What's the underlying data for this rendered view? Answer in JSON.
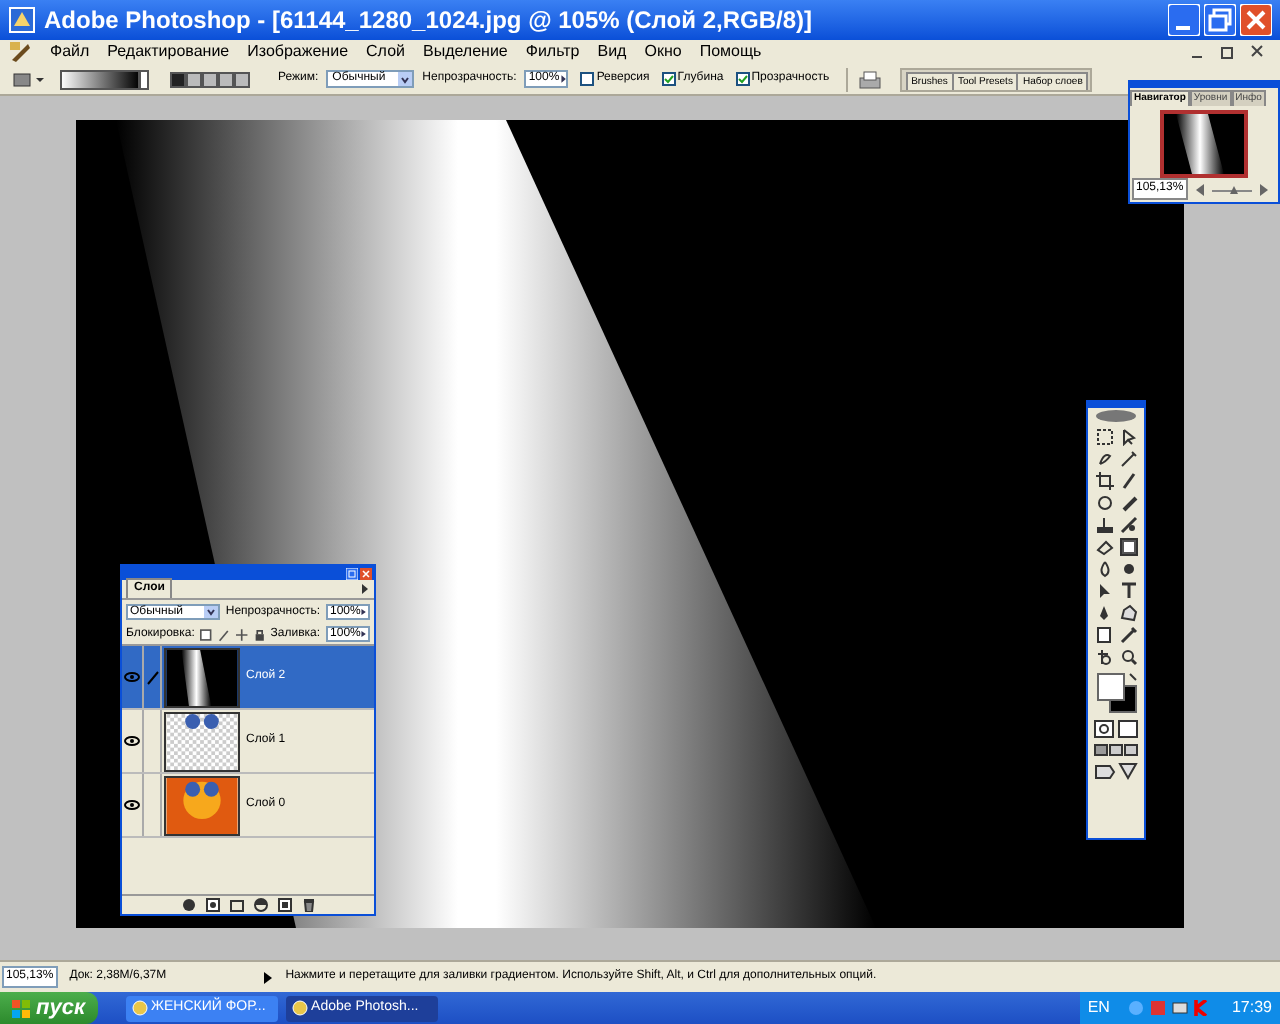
{
  "window": {
    "title": "Adobe Photoshop - [61144_1280_1024.jpg @ 105% (Слой 2,RGB/8)]"
  },
  "menu": [
    "Файл",
    "Редактирование",
    "Изображение",
    "Слой",
    "Выделение",
    "Фильтр",
    "Вид",
    "Окно",
    "Помощь"
  ],
  "options_bar": {
    "gradient_types": [
      {
        "selected": true
      },
      {
        "selected": false
      },
      {
        "selected": false
      },
      {
        "selected": false
      },
      {
        "selected": false
      }
    ],
    "mode_label": "Режим:",
    "mode": "Обычный",
    "opacity_label": "Непрозрачность:",
    "opacity": "100%",
    "checkboxes": [
      {
        "label": "Реверсия",
        "checked": false
      },
      {
        "label": "Глубина",
        "checked": true
      },
      {
        "label": "Прозрачность",
        "checked": true
      }
    ]
  },
  "palette_well": [
    "Brushes",
    "Tool Presets",
    "Набор слоев"
  ],
  "navigator": {
    "tabs": [
      {
        "label": "Навигатор",
        "selected": true
      },
      {
        "label": "Уровни",
        "selected": false
      },
      {
        "label": "Инфо",
        "selected": false
      }
    ],
    "zoom": "105,13%",
    "zoom_slider": {
      "level": 0.6
    }
  },
  "layers_panel": {
    "tab": "Слои",
    "mode": "Обычный",
    "opacity_label": "Непрозрачность:",
    "opacity": "100%",
    "lock_label": "Блокировка:",
    "fill_label": "Заливка:",
    "fill": "100%",
    "layers": [
      {
        "name": "Слой 2",
        "selected": true,
        "visible": true,
        "kind": "gradient"
      },
      {
        "name": "Слой 1",
        "selected": false,
        "visible": true,
        "kind": "transparent"
      },
      {
        "name": "Слой 0",
        "selected": false,
        "visible": true,
        "kind": "photo"
      }
    ]
  },
  "status_bar": {
    "zoom": "105,13%",
    "doc": "Док: 2,38M/6,37M",
    "message": "Нажмите и перетащите для заливки градиентом. Используйте Shift, Alt, и Ctrl для дополнительных опций."
  },
  "taskbar": {
    "start": "пуск",
    "tasks": [
      {
        "label": "ЖЕНСКИЙ ФОР...",
        "selected": false
      },
      {
        "label": "Adobe Photosh...",
        "selected": true
      }
    ],
    "language": "EN",
    "clock": "17:39"
  }
}
